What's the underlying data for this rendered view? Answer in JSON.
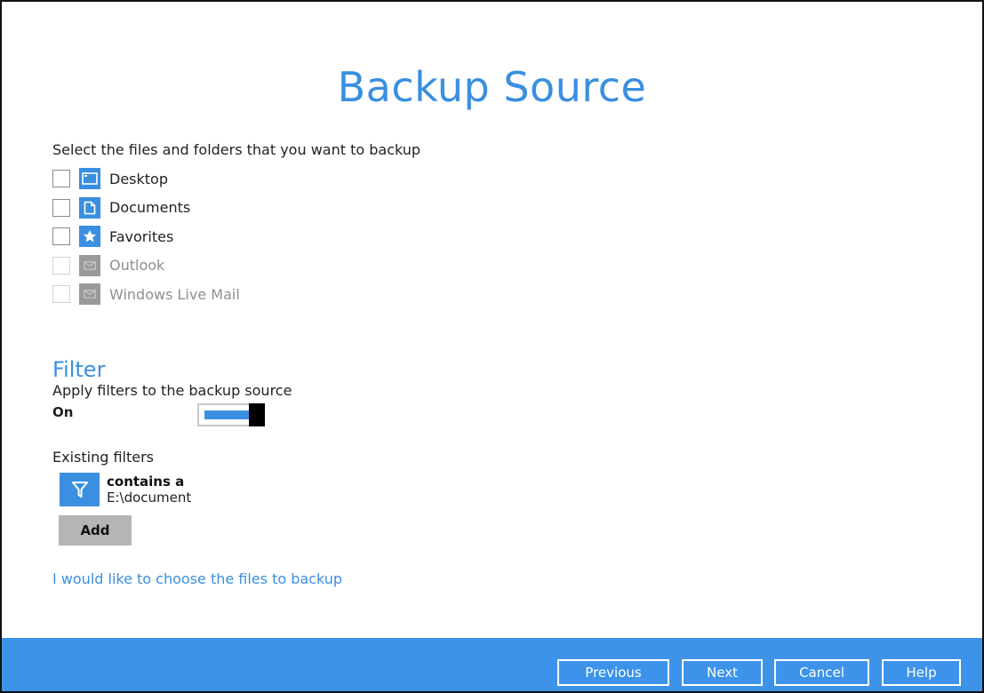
{
  "title": "Backup Source",
  "source_section": {
    "instruction": "Select the files and folders that you want to backup",
    "items": [
      {
        "label": "Desktop",
        "icon": "desktop-icon",
        "enabled": true,
        "checked": false
      },
      {
        "label": "Documents",
        "icon": "document-icon",
        "enabled": true,
        "checked": false
      },
      {
        "label": "Favorites",
        "icon": "star-icon",
        "enabled": true,
        "checked": false
      },
      {
        "label": "Outlook",
        "icon": "mail-icon",
        "enabled": false,
        "checked": false
      },
      {
        "label": "Windows Live Mail",
        "icon": "mail-icon",
        "enabled": false,
        "checked": false
      }
    ]
  },
  "filter_section": {
    "heading": "Filter",
    "apply_label": "Apply filters to the backup source",
    "toggle_state": "On",
    "toggle_on": true,
    "existing_label": "Existing filters",
    "filters": [
      {
        "name": "contains a",
        "value": "E:\\document",
        "icon": "funnel-icon"
      }
    ],
    "add_label": "Add"
  },
  "choose_link": "I would like to choose the files to backup",
  "footer": {
    "previous": "Previous",
    "next": "Next",
    "cancel": "Cancel",
    "help": "Help"
  },
  "colors": {
    "accent": "#3a8fe0",
    "footer": "#3d93ea",
    "disabled_icon": "#9a9a9a",
    "add_button": "#b5b5b5"
  }
}
